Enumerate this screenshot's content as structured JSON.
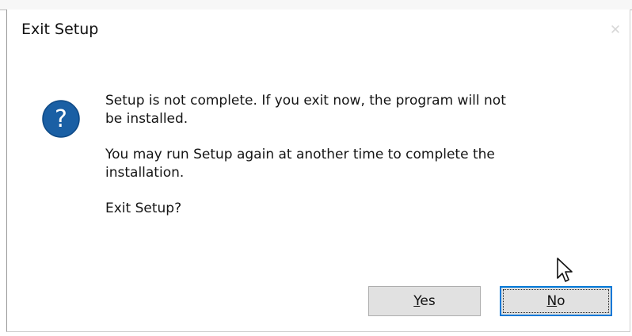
{
  "dialog": {
    "title": "Exit Setup",
    "close_glyph": "✕",
    "icon": "question-icon",
    "icon_color": "#1a5fa4",
    "message_lines": [
      "Setup is not complete. If you exit now, the program will not",
      "be installed.",
      "You may run Setup again at another time to complete the",
      "installation.",
      "Exit Setup?"
    ],
    "buttons": {
      "yes": {
        "mnemonic": "Y",
        "rest": "es"
      },
      "no": {
        "mnemonic": "N",
        "rest": "o"
      }
    },
    "focused_button": "No",
    "focus_color": "#0078d7"
  }
}
